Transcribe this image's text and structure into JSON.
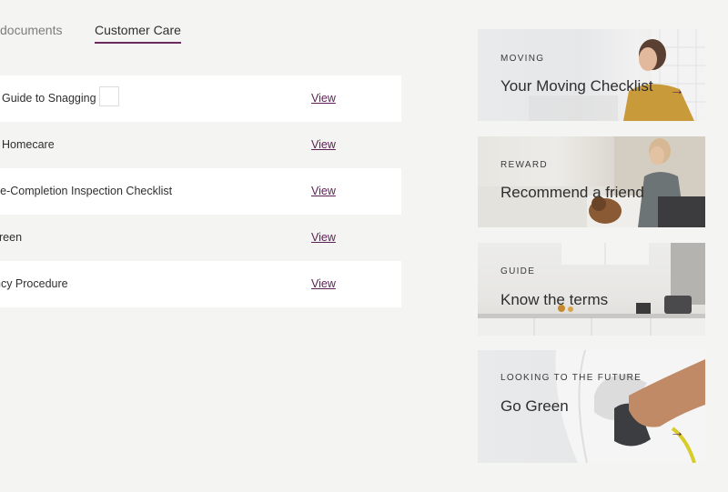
{
  "tabs": {
    "documents_label": "documents",
    "customer_care_label": "Customer Care"
  },
  "documents": [
    {
      "title": "Guide to Snagging",
      "action": "View"
    },
    {
      "title": "Homecare",
      "action": "View"
    },
    {
      "title": "re-Completion Inspection Checklist",
      "action": "View"
    },
    {
      "title": "reen",
      "action": "View"
    },
    {
      "title": "ncy Procedure",
      "action": "View"
    }
  ],
  "cards": [
    {
      "eyebrow": "MOVING",
      "title": "Your Moving Checklist"
    },
    {
      "eyebrow": "REWARD",
      "title": "Recommend a friend"
    },
    {
      "eyebrow": "GUIDE",
      "title": "Know the terms"
    },
    {
      "eyebrow": "LOOKING TO THE FUTURE",
      "title": "Go Green"
    }
  ],
  "colors": {
    "accent": "#5c2256",
    "tab_underline": "#6a2a60",
    "page_bg": "#f4f4f2",
    "row_bg": "#ffffff"
  }
}
